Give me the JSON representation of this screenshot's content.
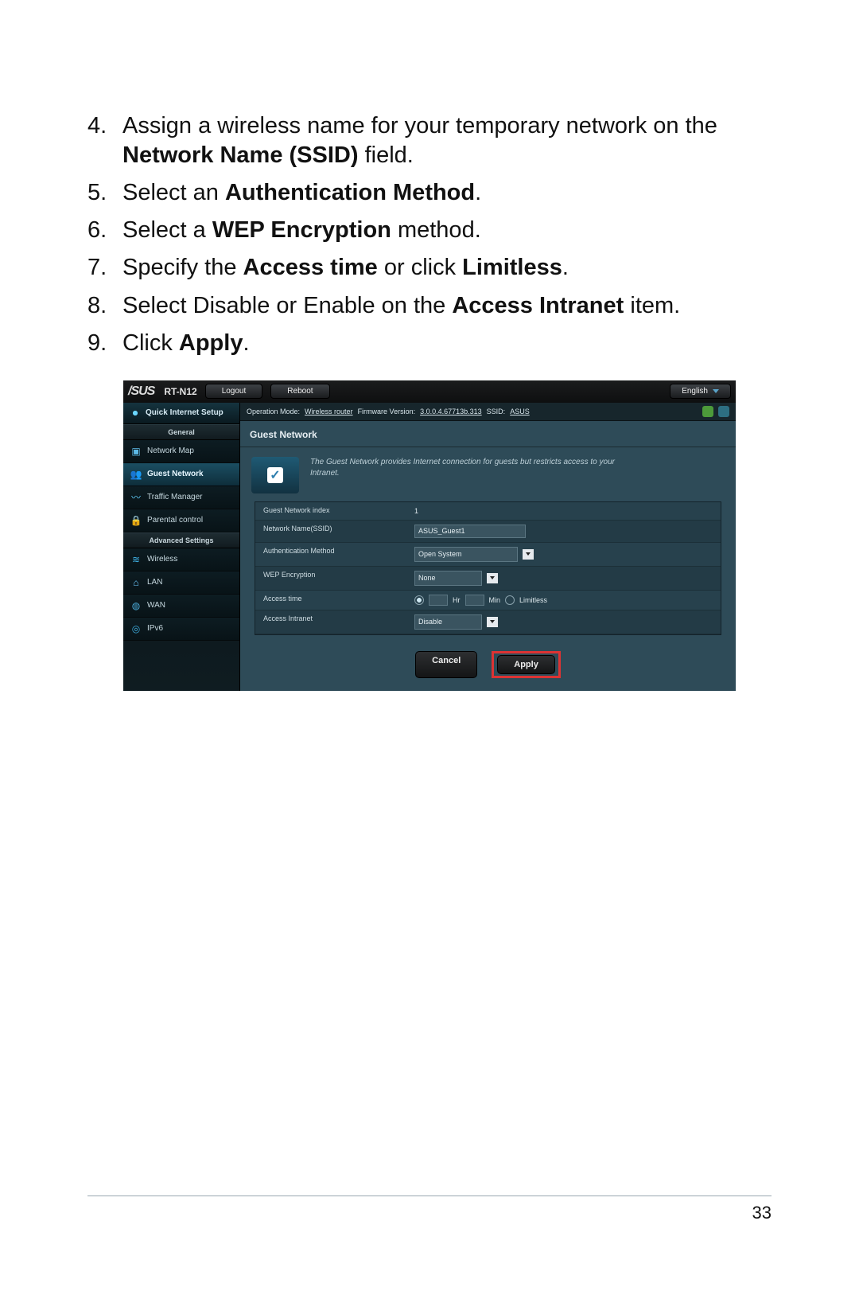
{
  "doc": {
    "steps": {
      "n4": "4.",
      "t4a": "Assign a wireless name for your temporary network on the ",
      "t4b": "Network Name (SSID)",
      "t4c": " field.",
      "n5": "5.",
      "t5a": "Select an ",
      "t5b": "Authentication Method",
      "t5c": ".",
      "n6": "6.",
      "t6a": "Select a ",
      "t6b": "WEP Encryption",
      "t6c": " method.",
      "n7": "7.",
      "t7a": "Specify the ",
      "t7b": "Access time",
      "t7c": " or click ",
      "t7d": "Limitless",
      "t7e": ".",
      "n8": "8.",
      "t8a": "Select Disable or Enable on the ",
      "t8b": "Access Intranet",
      "t8c": " item.",
      "n9": "9.",
      "t9a": "Click ",
      "t9b": "Apply",
      "t9c": "."
    },
    "page_number": "33"
  },
  "router": {
    "brand": "/SUS",
    "model": "RT-N12",
    "top": {
      "logout": "Logout",
      "reboot": "Reboot",
      "language": "English"
    },
    "info": {
      "op_label": "Operation Mode:",
      "op_value": "Wireless router",
      "fw_label": "Firmware Version:",
      "fw_value": "3.0.0.4.67713b.313",
      "ssid_label": "SSID:",
      "ssid_value": "ASUS"
    },
    "sidebar": {
      "qis": "Quick Internet Setup",
      "general_label": "General",
      "adv_label": "Advanced Settings",
      "items": {
        "nmap": "Network Map",
        "guest": "Guest Network",
        "traffic": "Traffic Manager",
        "parental": "Parental control",
        "wireless": "Wireless",
        "lan": "LAN",
        "wan": "WAN",
        "ipv6": "IPv6"
      }
    },
    "panel": {
      "title": "Guest Network",
      "hero": "The Guest Network provides Internet connection for guests but restricts access to your Intranet.",
      "rows": {
        "index_label": "Guest Network index",
        "index_value": "1",
        "ssid_label": "Network Name(SSID)",
        "ssid_value": "ASUS_Guest1",
        "auth_label": "Authentication Method",
        "auth_value": "Open System",
        "wep_label": "WEP Encryption",
        "wep_value": "None",
        "time_label": "Access time",
        "time_hr": "Hr",
        "time_min": "Min",
        "time_limitless": "Limitless",
        "intranet_label": "Access Intranet",
        "intranet_value": "Disable"
      },
      "buttons": {
        "cancel": "Cancel",
        "apply": "Apply"
      }
    }
  }
}
